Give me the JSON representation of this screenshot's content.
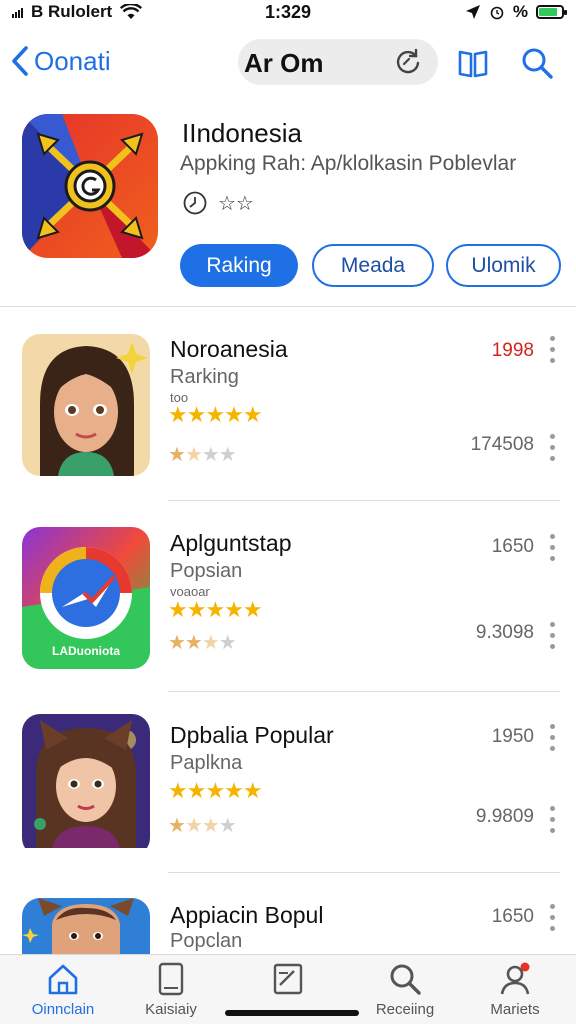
{
  "status_bar": {
    "carrier": "B Rulolert",
    "time": "1:329",
    "battery": "%"
  },
  "nav": {
    "back_label": "Oonati",
    "title": "Ar Om"
  },
  "featured": {
    "title": "IIndonesia",
    "subtitle": "Appking Rah: Ap/klolkasin Poblevlar",
    "rating_stars": "☆☆",
    "buttons": [
      "Raking",
      "Meada",
      "Ulomik"
    ],
    "colors": {
      "accent": "#1f6fe5"
    }
  },
  "list": [
    {
      "title": "Noroanesia",
      "subtitle": "Rarking",
      "subtitle2": "too",
      "stars_top": "★★★★★",
      "stars_bottom_filled": "★",
      "stars_bottom_partial": "★",
      "stars_bottom_empty": "★★",
      "value_top": "1998",
      "value_bottom": "174508"
    },
    {
      "title": "Aplguntstap",
      "subtitle": "Popsian",
      "subtitle2": "voaoar",
      "stars_top": "★★★★★",
      "stars_bottom_filled": "★★",
      "stars_bottom_partial": "★",
      "stars_bottom_empty": "★",
      "value_top": "1650",
      "value_bottom": "9.3098"
    },
    {
      "title": "Dpbalia Popular",
      "subtitle": "Paplkna",
      "subtitle2": "",
      "stars_top": "★★★★★",
      "stars_bottom_filled": "★",
      "stars_bottom_partial": "★★",
      "stars_bottom_empty": "★",
      "value_top": "1950",
      "value_bottom": "9.9809"
    },
    {
      "title": "Appiacin Bopul",
      "subtitle": "Popclan",
      "subtitle2": "",
      "stars_top": "",
      "stars_bottom_filled": "",
      "stars_bottom_partial": "",
      "stars_bottom_empty": "",
      "value_top": "1650",
      "value_bottom": ""
    }
  ],
  "row_icon_label": "LADuoniota",
  "tabs": [
    {
      "label": "Oinnclain",
      "icon": "home-icon",
      "active": true
    },
    {
      "label": "Kaisiaiy",
      "icon": "tablet-icon",
      "active": false
    },
    {
      "label": "...",
      "icon": "document-icon",
      "active": false
    },
    {
      "label": "Receiing",
      "icon": "search-icon",
      "active": false
    },
    {
      "label": "Mariets",
      "icon": "person-icon",
      "active": false
    }
  ]
}
